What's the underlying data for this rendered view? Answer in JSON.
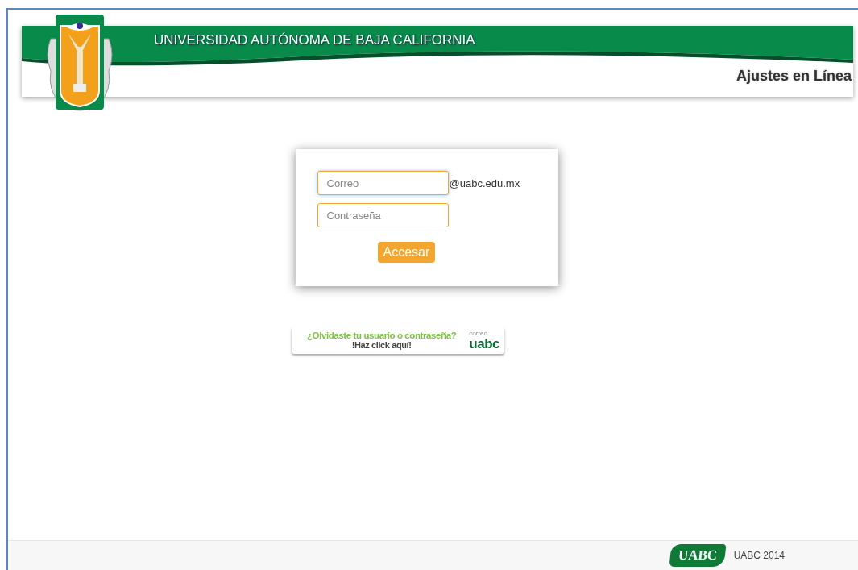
{
  "header": {
    "title": "UNIVERSIDAD AUTÓNOMA DE BAJA CALIFORNIA",
    "subtitle": "Ajustes en Línea"
  },
  "login": {
    "fields": [
      {
        "placeholder": "Correo",
        "suffix": "@uabc.edu.mx",
        "focused": true
      },
      {
        "placeholder": "Contraseña",
        "focused": false
      }
    ],
    "button": "Accesar"
  },
  "recovery_banner": {
    "question": "¿Olvidaste tu usuario o contraseña?",
    "action": "!Haz click aquí!",
    "brand_small": "correo",
    "brand": "uabc"
  },
  "footer": {
    "logo": "UABC",
    "text": "UABC 2014"
  }
}
